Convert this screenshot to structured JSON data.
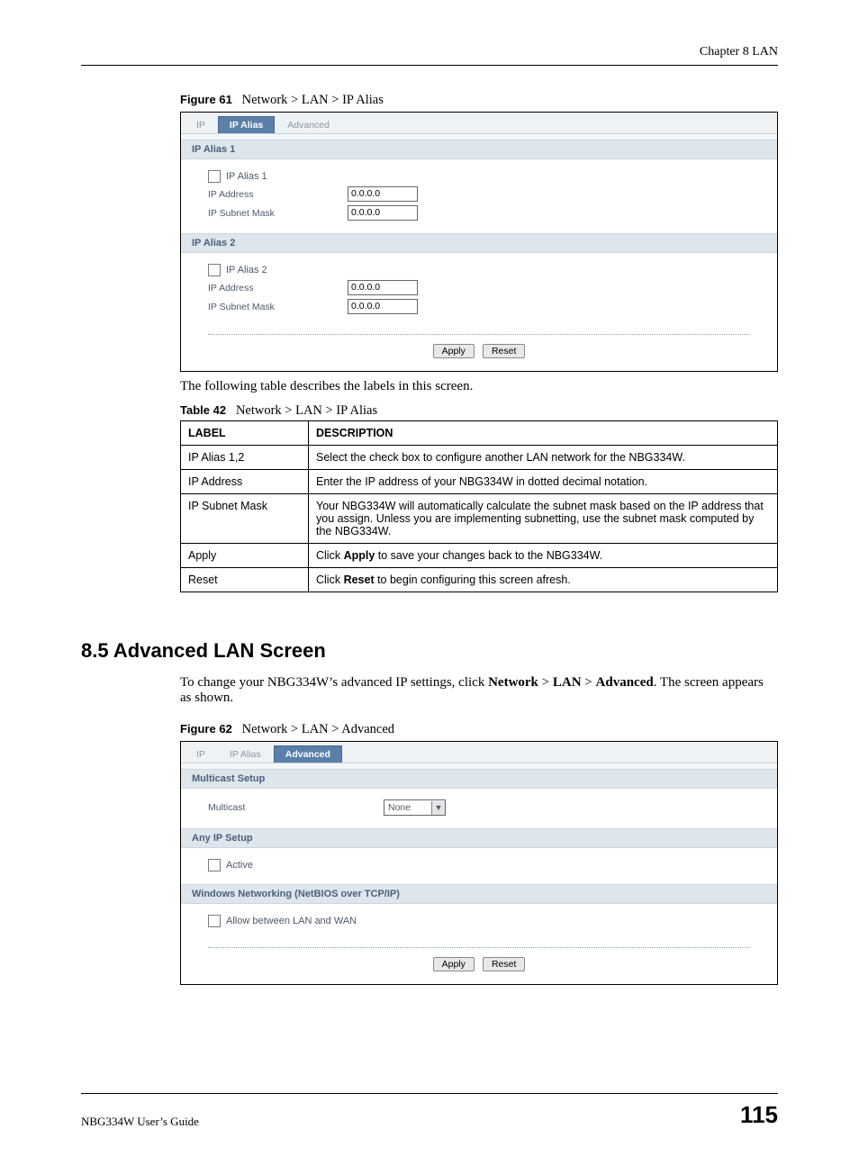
{
  "header": {
    "chapter": "Chapter 8 LAN"
  },
  "figure61": {
    "label": "Figure 61",
    "title": "Network > LAN > IP Alias",
    "tabs": {
      "ip": "IP",
      "alias": "IP Alias",
      "advanced": "Advanced"
    },
    "sec1": {
      "title": "IP Alias 1",
      "check_label": "IP Alias 1",
      "addr_label": "IP Address",
      "addr_value": "0.0.0.0",
      "mask_label": "IP Subnet Mask",
      "mask_value": "0.0.0.0"
    },
    "sec2": {
      "title": "IP Alias 2",
      "check_label": "IP Alias 2",
      "addr_label": "IP Address",
      "addr_value": "0.0.0.0",
      "mask_label": "IP Subnet Mask",
      "mask_value": "0.0.0.0"
    },
    "apply": "Apply",
    "reset": "Reset"
  },
  "para1": "The following table describes the labels in this screen.",
  "table42": {
    "label": "Table 42",
    "title": "Network > LAN > IP Alias",
    "head": {
      "c1": "LABEL",
      "c2": "DESCRIPTION"
    },
    "rows": [
      {
        "label": "IP Alias 1,2",
        "desc": "Select the check box to configure another LAN network for the NBG334W."
      },
      {
        "label": "IP Address",
        "desc": "Enter the IP address of your NBG334W in dotted decimal notation."
      },
      {
        "label": "IP Subnet Mask",
        "desc": "Your NBG334W will automatically calculate the subnet mask based on the IP address that you assign. Unless you are implementing subnetting, use the subnet mask computed by the NBG334W."
      },
      {
        "label": "Apply",
        "desc_pre": "Click ",
        "desc_bold": "Apply",
        "desc_post": " to save your changes back to the NBG334W."
      },
      {
        "label": "Reset",
        "desc_pre": "Click ",
        "desc_bold": "Reset",
        "desc_post": " to begin configuring this screen afresh."
      }
    ]
  },
  "section85": {
    "heading": "8.5  Advanced LAN Screen",
    "para_pre": "To change your NBG334W’s advanced IP settings, click ",
    "b1": "Network",
    "gt": " > ",
    "b2": "LAN",
    "b3": "Advanced",
    "para_post": ". The screen appears as shown."
  },
  "figure62": {
    "label": "Figure 62",
    "title": "Network > LAN > Advanced",
    "tabs": {
      "ip": "IP",
      "alias": "IP Alias",
      "advanced": "Advanced"
    },
    "sec_multi": {
      "title": "Multicast Setup",
      "label": "Multicast",
      "value": "None"
    },
    "sec_anyip": {
      "title": "Any IP Setup",
      "check_label": "Active"
    },
    "sec_netbios": {
      "title": "Windows Networking (NetBIOS over TCP/IP)",
      "check_label": "Allow between LAN and WAN"
    },
    "apply": "Apply",
    "reset": "Reset"
  },
  "footer": {
    "guide": "NBG334W User’s Guide",
    "page": "115"
  }
}
